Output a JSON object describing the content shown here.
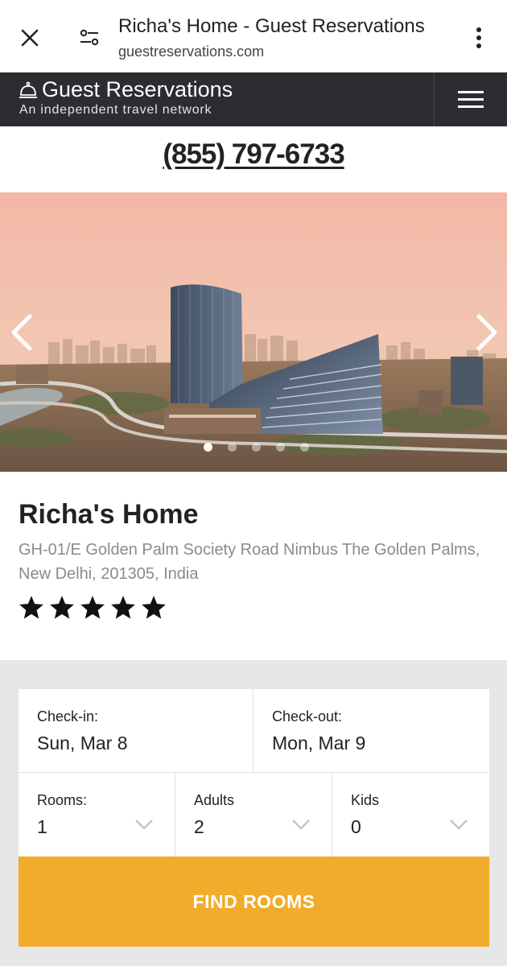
{
  "browser": {
    "title": "Richa's Home - Guest Reservations",
    "url": "guestreservations.com"
  },
  "site": {
    "brand": "Guest Reservations",
    "tagline": "An independent travel network",
    "phone": "(855) 797-6733"
  },
  "hero": {
    "slide_count": 5,
    "active_slide": 1
  },
  "property": {
    "name": "Richa's Home",
    "address": "GH-01/E Golden Palm Society Road Nimbus The Golden Palms, New Delhi, 201305, India",
    "stars": 5
  },
  "booking": {
    "checkin_label": "Check-in:",
    "checkin_value": "Sun, Mar 8",
    "checkout_label": "Check-out:",
    "checkout_value": "Mon, Mar 9",
    "rooms_label": "Rooms:",
    "rooms_value": "1",
    "adults_label": "Adults",
    "adults_value": "2",
    "kids_label": "Kids",
    "kids_value": "0",
    "button_label": "FIND ROOMS"
  },
  "colors": {
    "header_bg": "#2b2d30",
    "button_bg": "#f0ac2a",
    "panel_bg": "#e7e7e7"
  }
}
